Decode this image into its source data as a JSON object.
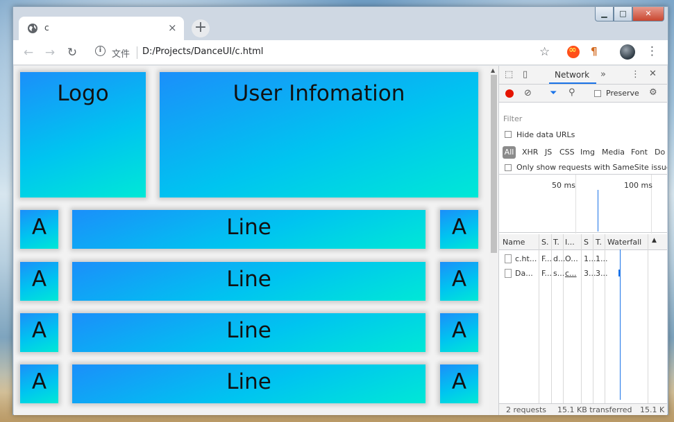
{
  "tab": {
    "title": "c",
    "close": "×"
  },
  "newtab": "+",
  "window_controls": {
    "minimize": "▁",
    "maximize": "□",
    "close": "✕"
  },
  "toolbar": {
    "back": "←",
    "forward": "→",
    "reload": "↻",
    "info": "i",
    "scheme": "文件",
    "url": "D:/Projects/DanceUI/c.html",
    "star": "☆",
    "menu": "⋮"
  },
  "page": {
    "logo": "Logo",
    "user_info": "User Infomation",
    "rows": [
      {
        "left": "A",
        "line": "Line",
        "right": "A"
      },
      {
        "left": "A",
        "line": "Line",
        "right": "A"
      },
      {
        "left": "A",
        "line": "Line",
        "right": "A"
      },
      {
        "left": "A",
        "line": "Line",
        "right": "A"
      }
    ],
    "colors": {
      "gradient_start": "#1b8ffa",
      "gradient_end": "#00e8d6"
    }
  },
  "devtools": {
    "tab": "Network",
    "more_tabs": "»",
    "preserve_label": "Preserve",
    "filter_placeholder": "Filter",
    "hide_data_urls": "Hide data URLs",
    "types": [
      "All",
      "XHR",
      "JS",
      "CSS",
      "Img",
      "Media",
      "Font",
      "Do"
    ],
    "samesite": "Only show requests with SameSite issues",
    "timeline_labels": [
      "50 ms",
      "100 ms"
    ],
    "columns": [
      "Name",
      "S.",
      "T.",
      "I...",
      "S",
      "T.",
      "Waterfall"
    ],
    "requests": [
      {
        "name": "c.ht...",
        "status": "F...",
        "type": "d...",
        "initiator": "O...",
        "size": "1...",
        "time": "1..."
      },
      {
        "name": "Da...",
        "status": "F...",
        "type": "s...",
        "initiator": "c...",
        "size": "3...",
        "time": "3..."
      }
    ],
    "status": {
      "requests": "2 requests",
      "transferred": "15.1 KB transferred",
      "resources": "15.1 K"
    }
  }
}
